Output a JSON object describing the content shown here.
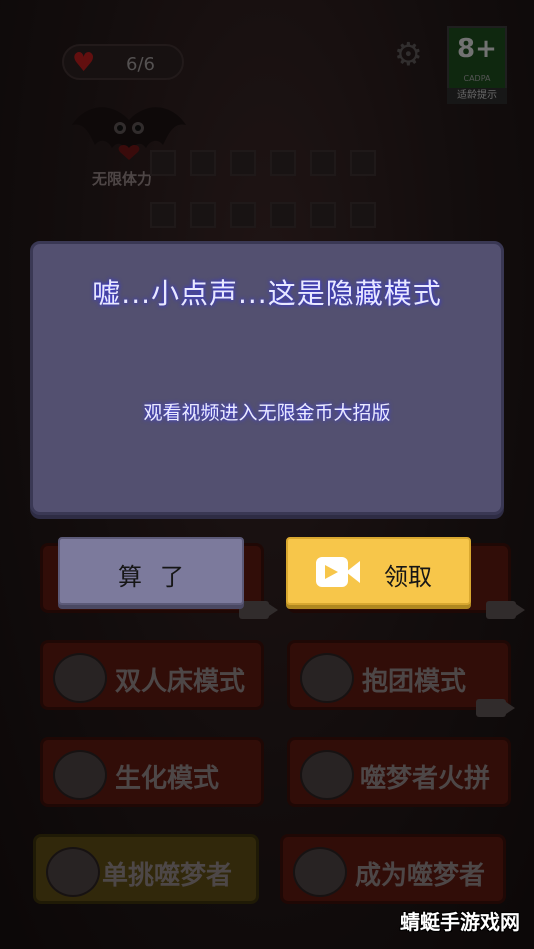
{
  "hud": {
    "hearts_text": "6/6",
    "age_rating": "8+",
    "age_org": "CADPA",
    "age_tip": "适龄提示",
    "unlimited_stamina": "无限体力"
  },
  "modes": [
    {
      "label": "双人床模式"
    },
    {
      "label": "抱团模式"
    },
    {
      "label": "生化模式"
    },
    {
      "label": "噬梦者火拼"
    },
    {
      "label": "单挑噬梦者"
    },
    {
      "label": "成为噬梦者"
    }
  ],
  "dialog": {
    "title": "嘘...小点声...这是隐藏模式",
    "subtitle": "观看视频进入无限金币大招版",
    "cancel_label": "算了",
    "claim_label": "领取"
  },
  "watermark": "蜻蜓手游戏网",
  "colors": {
    "dialog_bg": "#535070",
    "claim_button": "#f7c64a",
    "cancel_button": "#7c7a9c",
    "mode_button": "#5a1810"
  }
}
